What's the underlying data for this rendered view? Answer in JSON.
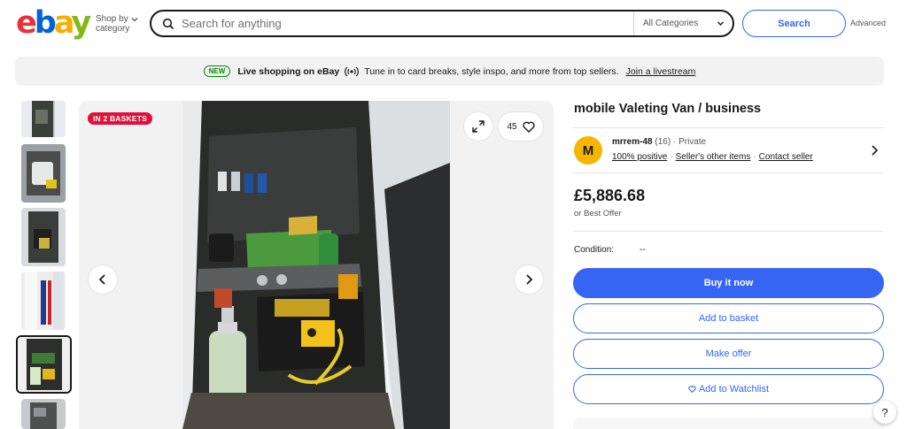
{
  "header": {
    "logo_letters": [
      "e",
      "b",
      "a",
      "y"
    ],
    "shop_by_line1": "Shop by",
    "shop_by_line2": "category",
    "search_placeholder": "Search for anything",
    "category_select": "All Categories",
    "search_button": "Search",
    "advanced": "Advanced"
  },
  "promo": {
    "badge": "NEW",
    "title": "Live shopping on eBay",
    "text": "Tune in to card breaks, style inspo, and more from top sellers.",
    "link": "Join a livestream"
  },
  "gallery": {
    "badge": "IN 2 BASKETS",
    "watch_count": "45",
    "thumbnail_count": 6,
    "active_thumbnail": 5
  },
  "item": {
    "title": "mobile Valeting Van / business",
    "price": "£5,886.68",
    "offer_note": "or Best Offer",
    "condition_label": "Condition:",
    "condition_value": "--"
  },
  "seller": {
    "avatar_letter": "M",
    "name": "mrrem-48",
    "feedback": "(16)",
    "dot": "·",
    "type": "Private",
    "positive": "100% positive",
    "other_items": "Seller's other items",
    "contact": "Contact seller"
  },
  "actions": {
    "buy_now": "Buy it now",
    "add_to_basket": "Add to basket",
    "make_offer": "Make offer",
    "add_to_watchlist": "Add to Watchlist"
  },
  "help": "?",
  "colors": {
    "ebay_red": "#e53238",
    "ebay_blue": "#0064d2",
    "ebay_yellow": "#f5af02",
    "ebay_green": "#86b817",
    "accent_blue": "#3665f3",
    "badge_red": "#e0103a",
    "new_green": "#008a00"
  }
}
